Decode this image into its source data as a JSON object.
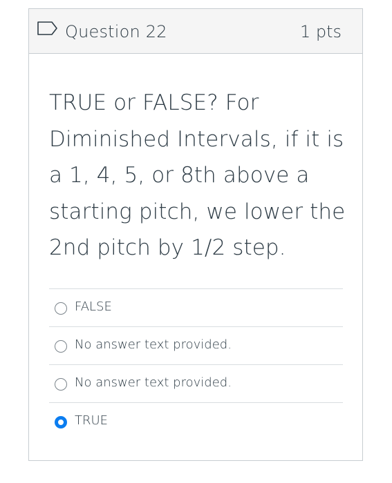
{
  "question": {
    "title": "Question 22",
    "points": "1 pts",
    "text": "TRUE or FALSE?  For Diminished Intervals, if it is a 1, 4, 5, or  8th above a starting pitch, we lower the 2nd pitch by 1/2 step."
  },
  "answers": [
    {
      "label": "FALSE",
      "selected": false
    },
    {
      "label": "No answer text provided.",
      "selected": false
    },
    {
      "label": "No answer text provided.",
      "selected": false
    },
    {
      "label": "TRUE",
      "selected": true
    }
  ],
  "colors": {
    "accent": "#0b7df0",
    "text": "#2d3b45",
    "header_bg": "#f5f5f5",
    "border": "#c7cdd1"
  },
  "icons": {
    "flag": "flag-outline-icon"
  }
}
